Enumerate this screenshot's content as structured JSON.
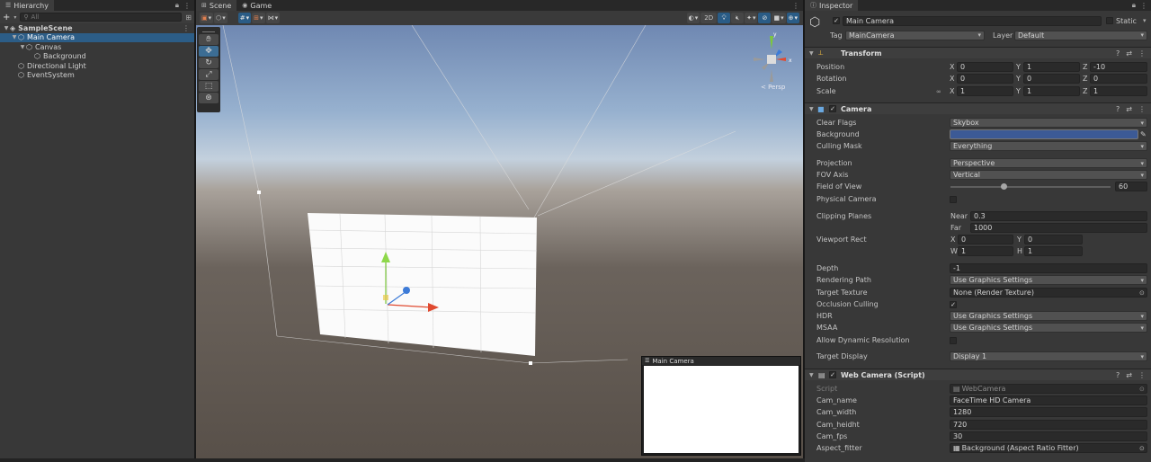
{
  "hierarchy": {
    "tab": "Hierarchy",
    "search_placeholder": "All",
    "items": [
      {
        "label": "SampleScene",
        "depth": 0,
        "arrow": "▼",
        "icon": "unity-scene-icon",
        "selected": false
      },
      {
        "label": "Main Camera",
        "depth": 1,
        "arrow": "▼",
        "icon": "cube-icon",
        "selected": true
      },
      {
        "label": "Canvas",
        "depth": 2,
        "arrow": "▼",
        "icon": "cube-icon",
        "selected": false
      },
      {
        "label": "Background",
        "depth": 3,
        "arrow": "",
        "icon": "cube-icon",
        "selected": false
      },
      {
        "label": "Directional Light",
        "depth": 1,
        "arrow": "",
        "icon": "cube-icon",
        "selected": false
      },
      {
        "label": "EventSystem",
        "depth": 1,
        "arrow": "",
        "icon": "cube-icon",
        "selected": false
      }
    ]
  },
  "scene": {
    "tabs": [
      "Scene",
      "Game"
    ],
    "mode_2d": "2D",
    "persp_label": "< Persp",
    "preview_title": "Main Camera",
    "tools": [
      "hand-tool-icon",
      "move-tool-icon",
      "rotate-tool-icon",
      "scale-tool-icon",
      "rect-tool-icon",
      "transform-tool-icon"
    ]
  },
  "inspector": {
    "tab": "Inspector",
    "object_name": "Main Camera",
    "static_label": "Static",
    "tag_label": "Tag",
    "tag_value": "MainCamera",
    "layer_label": "Layer",
    "layer_value": "Default",
    "transform": {
      "title": "Transform",
      "position_label": "Position",
      "position": [
        "0",
        "1",
        "-10"
      ],
      "rotation_label": "Rotation",
      "rotation": [
        "0",
        "0",
        "0"
      ],
      "scale_label": "Scale",
      "scale": [
        "1",
        "1",
        "1"
      ],
      "axes": [
        "X",
        "Y",
        "Z"
      ]
    },
    "camera": {
      "title": "Camera",
      "clear_flags_label": "Clear Flags",
      "clear_flags": "Skybox",
      "background_label": "Background",
      "background_color": "#3c5a96",
      "culling_mask_label": "Culling Mask",
      "culling_mask": "Everything",
      "projection_label": "Projection",
      "projection": "Perspective",
      "fov_axis_label": "FOV Axis",
      "fov_axis": "Vertical",
      "fov_label": "Field of View",
      "fov": "60",
      "fov_fraction": 0.33,
      "physical_label": "Physical Camera",
      "clipping_label": "Clipping Planes",
      "near_label": "Near",
      "near": "0.3",
      "far_label": "Far",
      "far": "1000",
      "viewport_label": "Viewport Rect",
      "vp_x_label": "X",
      "vp_x": "0",
      "vp_y_label": "Y",
      "vp_y": "0",
      "vp_w_label": "W",
      "vp_w": "1",
      "vp_h_label": "H",
      "vp_h": "1",
      "depth_label": "Depth",
      "depth": "-1",
      "rendering_path_label": "Rendering Path",
      "rendering_path": "Use Graphics Settings",
      "target_texture_label": "Target Texture",
      "target_texture": "None (Render Texture)",
      "occlusion_label": "Occlusion Culling",
      "hdr_label": "HDR",
      "hdr": "Use Graphics Settings",
      "msaa_label": "MSAA",
      "msaa": "Use Graphics Settings",
      "dyn_res_label": "Allow Dynamic Resolution",
      "target_display_label": "Target Display",
      "target_display": "Display 1"
    },
    "script": {
      "title": "Web Camera (Script)",
      "script_label": "Script",
      "script_value": "WebCamera",
      "cam_name_label": "Cam_name",
      "cam_name": "FaceTime HD Camera",
      "cam_width_label": "Cam_width",
      "cam_width": "1280",
      "cam_height_label": "Cam_heidht",
      "cam_height": "720",
      "cam_fps_label": "Cam_fps",
      "cam_fps": "30",
      "aspect_label": "Aspect_fitter",
      "aspect_value": "Background (Aspect Ratio Fitter)"
    }
  }
}
